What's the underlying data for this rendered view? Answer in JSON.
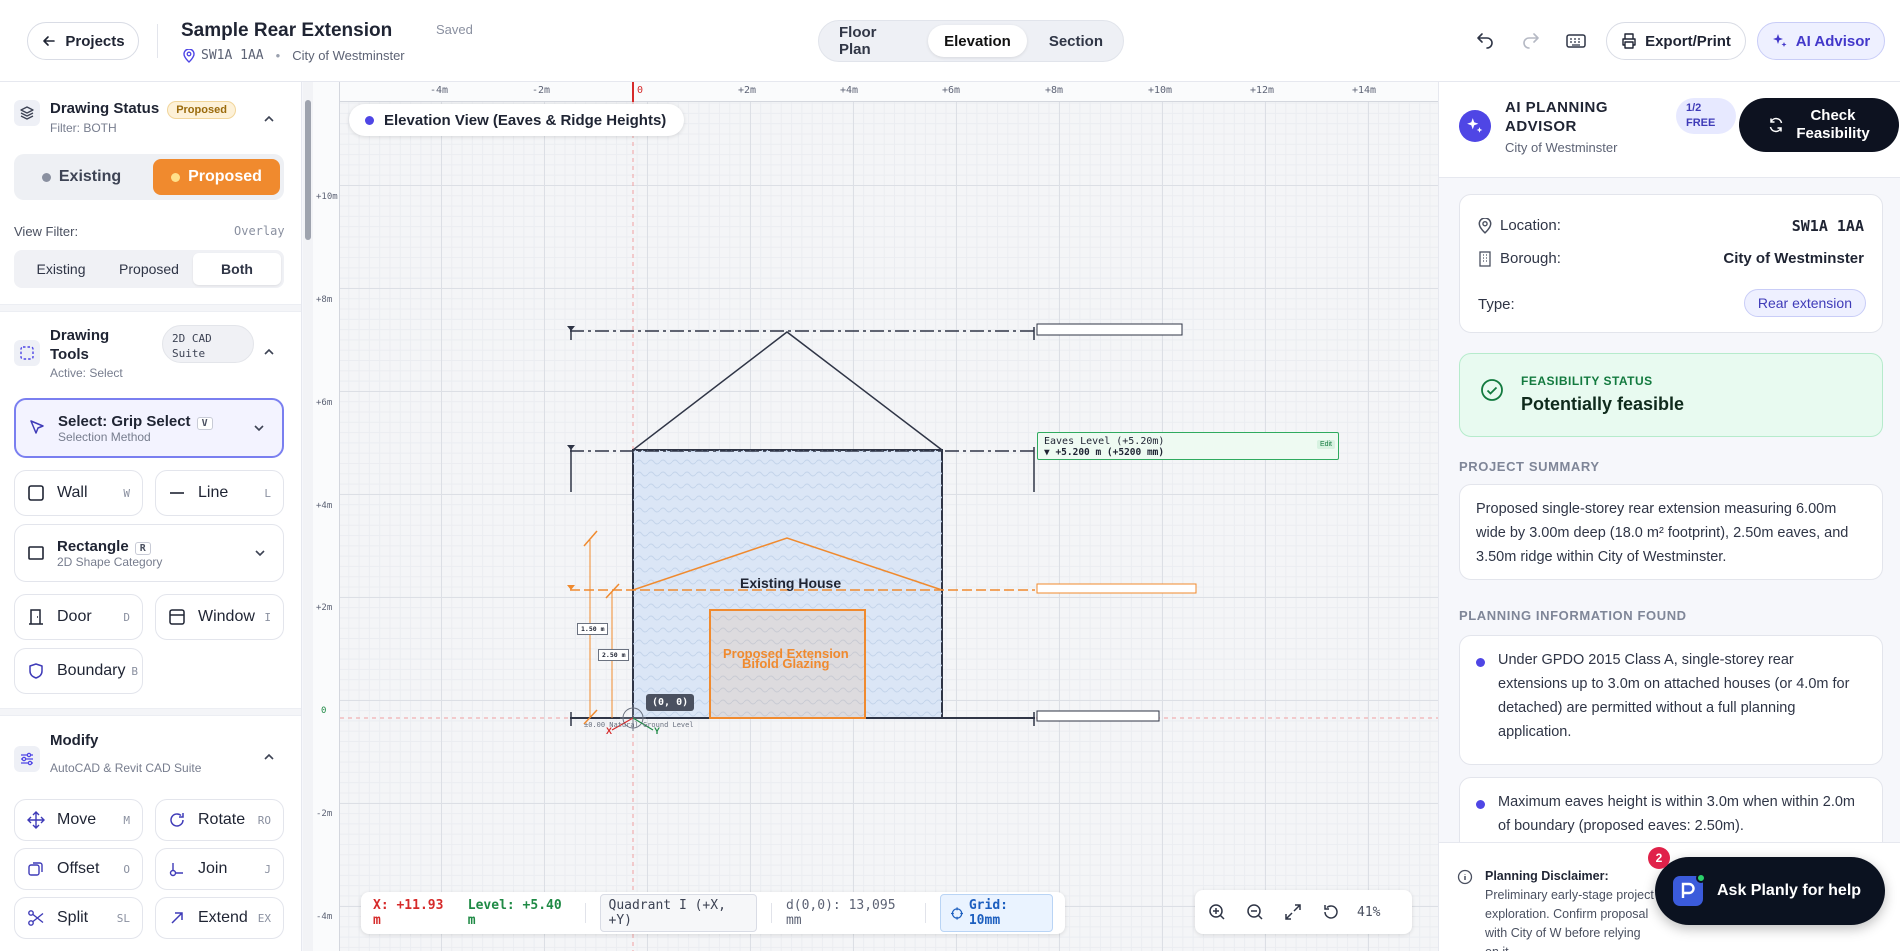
{
  "header": {
    "projects_label": "Projects",
    "title": "Sample Rear Extension",
    "saved": "Saved",
    "postcode": "SW1A 1AA",
    "council": "City of Westminster",
    "view_tabs": [
      "Floor Plan",
      "Elevation",
      "Section"
    ],
    "active_view": "Elevation",
    "export_label": "Export/Print",
    "ai_label": "AI Advisor"
  },
  "left": {
    "drawing_status": {
      "title": "Drawing Status",
      "badge": "Proposed",
      "filter": "Filter: BOTH",
      "options": [
        "Existing",
        "Proposed"
      ],
      "active": "Proposed"
    },
    "view_filter": {
      "label": "View Filter:",
      "overlay": "Overlay",
      "options": [
        "Existing",
        "Proposed",
        "Both"
      ],
      "active": "Both"
    },
    "drawing_tools": {
      "title_line1": "Drawing",
      "title_line2": "Tools",
      "badge_line1": "2D CAD",
      "badge_line2": "Suite",
      "active": "Active: Select",
      "select_title": "Select: Grip Select",
      "select_key": "V",
      "select_sub": "Selection Method",
      "wall": "Wall",
      "wall_key": "W",
      "line": "Line",
      "line_key": "L",
      "rect_title": "Rectangle",
      "rect_key": "R",
      "rect_sub": "2D Shape Category",
      "door": "Door",
      "door_key": "D",
      "window": "Window",
      "window_key": "I",
      "boundary": "Boundary",
      "boundary_key": "B"
    },
    "modify": {
      "title": "Modify",
      "sub": "AutoCAD & Revit CAD Suite",
      "move": "Move",
      "move_key": "M",
      "rotate": "Rotate",
      "rotate_key": "RO",
      "offset": "Offset",
      "offset_key": "O",
      "join": "Join",
      "join_key": "J",
      "split": "Split",
      "split_key": "SL",
      "extend": "Extend",
      "extend_key": "EX"
    }
  },
  "canvas": {
    "view_title": "Elevation View (Eaves & Ridge Heights)",
    "ruler_x": [
      "-4m",
      "-2m",
      "0",
      "+2m",
      "+4m",
      "+6m",
      "+8m",
      "+10m",
      "+12m",
      "+14m"
    ],
    "ruler_y": [
      "+10m",
      "+8m",
      "+6m",
      "+4m",
      "+2m",
      "0",
      "-2m",
      "-4m"
    ],
    "eaves_label": "Eaves Level (+5.20m)",
    "eaves_value": "▼ +5.200 m (+5200 mm)",
    "eaves_edit": "Edit",
    "existing_house": "Existing House",
    "proposed_ext": "Proposed Extension",
    "bifold": "Bifold Glazing",
    "dim_150": "1.50 m",
    "dim_250": "2.50 m",
    "origin": "(0, 0)",
    "ground": "±0.00 Natural Ground Level",
    "axis_x": "X",
    "axis_y": "Y",
    "status": {
      "x": "X: +11.93 m",
      "level": "Level: +5.40 m",
      "quadrant": "Quadrant I (+X, +Y)",
      "dist": "d(0,0): 13,095 mm",
      "grid": "Grid: 10mm"
    },
    "zoom": "41%"
  },
  "right": {
    "title_line1": "AI PLANNING",
    "title_line2": "ADVISOR",
    "council": "City of Westminster",
    "free_line1": "1/2",
    "free_line2": "FREE",
    "check_line1": "Check",
    "check_line2": "Feasibility",
    "location_label": "Location:",
    "location_value": "SW1A 1AA",
    "borough_label": "Borough:",
    "borough_value": "City of Westminster",
    "type_label": "Type:",
    "type_value": "Rear extension",
    "feas_label": "FEASIBILITY STATUS",
    "feas_value": "Potentially feasible",
    "summary_caption": "PROJECT SUMMARY",
    "summary": "Proposed single-storey rear extension measuring 6.00m wide by 3.00m deep (18.0 m² footprint), 2.50m eaves, and 3.50m ridge within City of Westminster.",
    "info_caption": "PLANNING INFORMATION FOUND",
    "info": [
      "Under GPDO 2015 Class A, single-storey rear extensions up to 3.0m on attached houses (or 4.0m for detached) are permitted without a full planning application.",
      "Maximum eaves height is within 3.0m when within 2.0m of boundary (proposed eaves: 2.50m)."
    ],
    "disclaimer_title": "Planning Disclaimer:",
    "disclaimer_text": "Preliminary early-stage project exploration. Confirm proposal with City of W before relying on it.",
    "help_label": "Ask Planly for help",
    "help_count": "2"
  },
  "colors": {
    "accent": "#4f46e5",
    "proposed": "#f08a2e",
    "existing_fill": "#dbe6f6",
    "feasible": "#137a3f"
  }
}
